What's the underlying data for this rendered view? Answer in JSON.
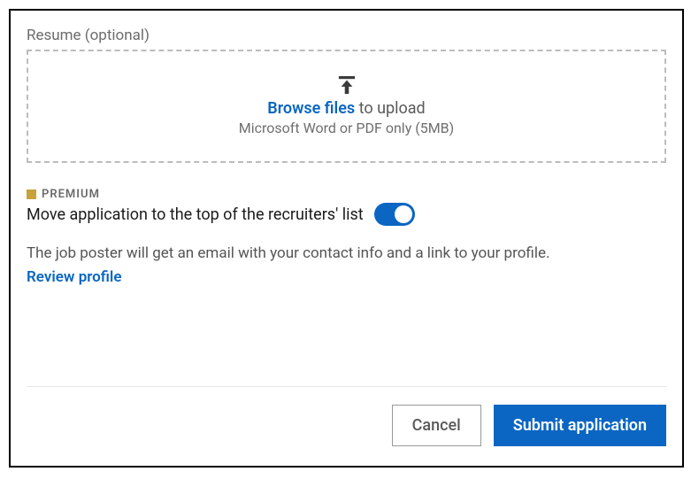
{
  "resume": {
    "label": "Resume (optional)",
    "browse": "Browse files",
    "upload_suffix": " to upload",
    "hint": "Microsoft Word or PDF only (5MB)"
  },
  "premium": {
    "badge": "PREMIUM",
    "feature": "Move application to the top of the recruiters' list",
    "toggle_on": true
  },
  "info": {
    "text": "The job poster will get an email with your contact info and a link to your profile.",
    "review": "Review profile"
  },
  "footer": {
    "cancel": "Cancel",
    "submit": "Submit application"
  },
  "colors": {
    "accent": "#0a66c2",
    "premium_gold": "#c6a23a"
  }
}
